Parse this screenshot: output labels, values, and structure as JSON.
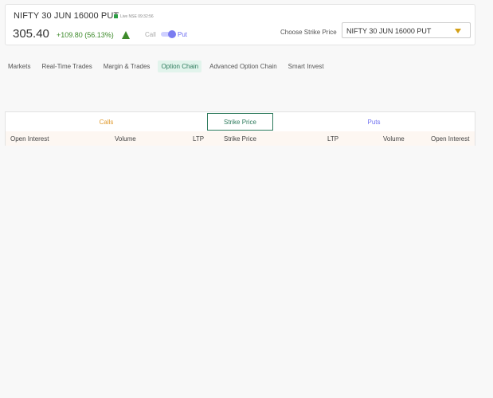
{
  "header": {
    "title": "NIFTY 30 JUN 16000 PUT",
    "live_text": "Live  NSE 09:32:56",
    "price_int": "305.",
    "price_dec": "40",
    "change": "+109.80 (56.13%)",
    "call_label": "Call",
    "put_label": "Put",
    "strike_label": "Choose Strike Price",
    "strike_value": "NIFTY 30 JUN 16000 PUT"
  },
  "nav": {
    "items": [
      "Markets",
      "Real-Time Trades",
      "Margin & Trades",
      "Option Chain",
      "Advanced Option Chain",
      "Smart Invest"
    ],
    "active": "Option Chain"
  },
  "table": {
    "groups": {
      "calls": "Calls",
      "strike": "Strike Price",
      "puts": "Puts"
    },
    "columns": [
      "Open Interest",
      "Volume",
      "LTP",
      "Strike Price",
      "LTP",
      "Volume",
      "Open Interest"
    ]
  },
  "colors": {
    "accent_green": "#2d7a5c",
    "up_green": "#3d8a2a",
    "calls_orange": "#e09a2c",
    "puts_purple": "#6b6cf0"
  }
}
